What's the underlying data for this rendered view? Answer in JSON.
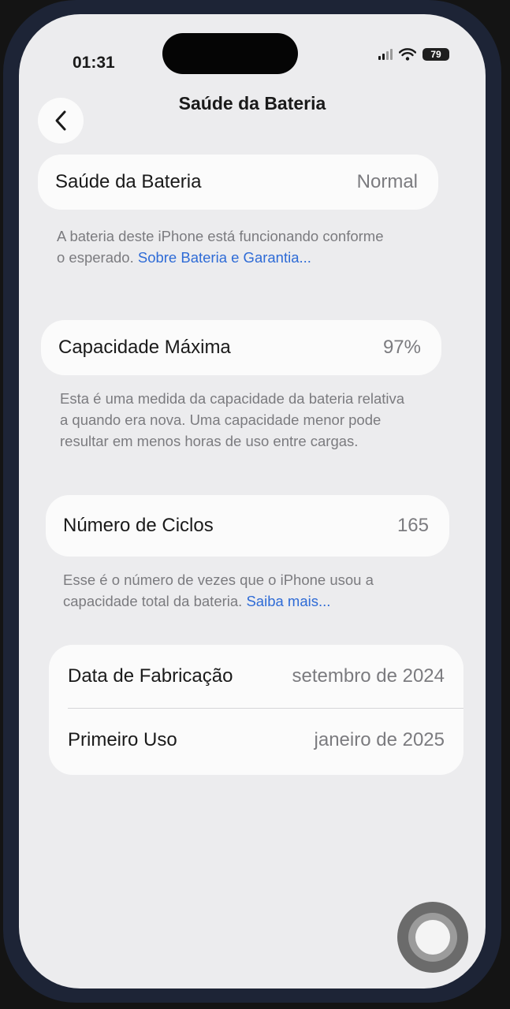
{
  "status_bar": {
    "time": "01:31",
    "battery_level": "79",
    "signal_icon": "cellular-signal-icon",
    "wifi_icon": "wifi-icon"
  },
  "nav": {
    "back_icon": "chevron-left-icon",
    "title": "Saúde da Bateria"
  },
  "battery_health": {
    "label": "Saúde da Bateria",
    "value": "Normal",
    "description": "A bateria deste iPhone está funcionando conforme o esperado.",
    "link": "Sobre Bateria e Garantia..."
  },
  "max_capacity": {
    "label": "Capacidade Máxima",
    "value": "97%",
    "description": "Esta é uma medida da capacidade da bateria relativa a quando era nova. Uma capacidade menor pode resultar em menos horas de uso entre cargas."
  },
  "cycle_count": {
    "label": "Número de Ciclos",
    "value": "165",
    "description": "Esse é o número de vezes que o iPhone usou a capacidade total da bateria.",
    "link": "Saiba mais..."
  },
  "dates": {
    "manufacture_label": "Data de Fabricação",
    "manufacture_value": "setembro de 2024",
    "first_use_label": "Primeiro Uso",
    "first_use_value": "janeiro de 2025"
  },
  "colors": {
    "link": "#2e6bd6",
    "background": "#ececee",
    "card": "#fbfbfb",
    "secondary_text": "#7b7b7f"
  }
}
